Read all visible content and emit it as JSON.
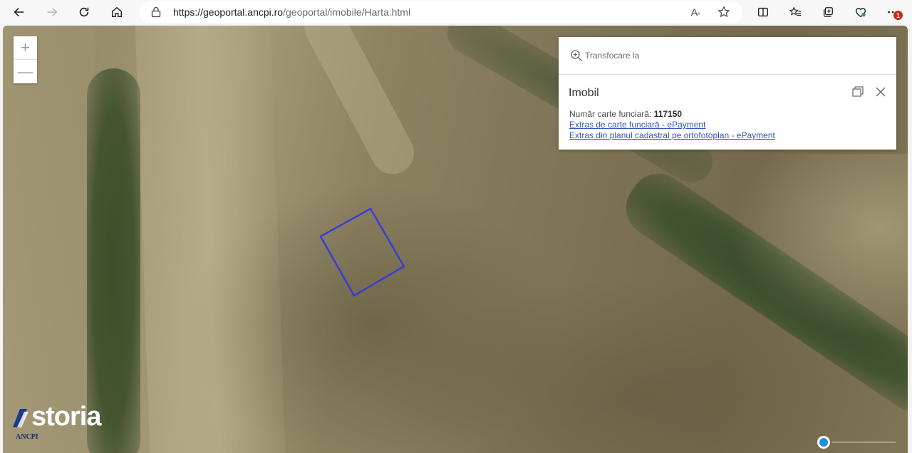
{
  "browser": {
    "url_host": "https://geoportal.ancpi.ro",
    "url_path": "/geoportal/imobile/Harta.html",
    "notification_count": "1"
  },
  "map": {
    "zoom_in_label": "+",
    "zoom_out_label": "—",
    "parcel_color": "#3b3bd6"
  },
  "panel": {
    "search_placeholder": "Transfocare la",
    "title": "Imobil",
    "cf_label": "Număr carte funciară: ",
    "cf_number": "117150",
    "link1": "Extras de carte funciară - ePayment",
    "link2": "Extras din planul cadastral pe ortofotoplan - ePayment"
  },
  "logo": {
    "brand": "storia",
    "agency": "ANCPI"
  }
}
